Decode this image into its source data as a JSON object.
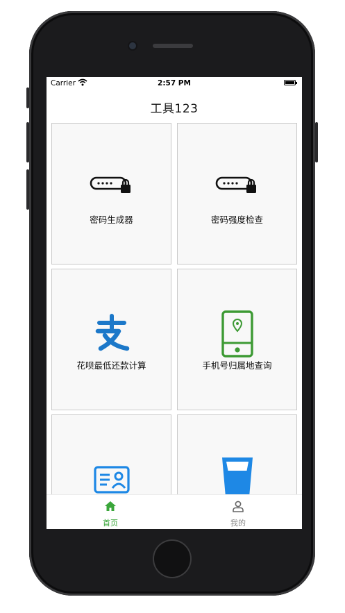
{
  "status_bar": {
    "carrier": "Carrier",
    "time": "2:57 PM"
  },
  "nav": {
    "title": "工具123"
  },
  "tools": [
    {
      "label": "密码生成器",
      "icon": "password-lock-icon"
    },
    {
      "label": "密码强度检查",
      "icon": "password-lock-icon"
    },
    {
      "label": "花呗最低还款计算",
      "icon": "alipay-icon"
    },
    {
      "label": "手机号归属地查询",
      "icon": "phone-location-icon"
    },
    {
      "label": "",
      "icon": "id-card-icon"
    },
    {
      "label": "",
      "icon": "water-glass-icon"
    }
  ],
  "tab_bar": {
    "tabs": [
      {
        "label": "首页",
        "icon": "home-icon",
        "active": true
      },
      {
        "label": "我的",
        "icon": "user-icon",
        "active": false
      }
    ]
  },
  "colors": {
    "tab_active": "#3aa63a",
    "tab_inactive": "#8a8a8a",
    "alipay_blue": "#1c78c9",
    "phone_green": "#3d9a34",
    "id_card_blue": "#1e88e5",
    "glass_blue": "#1e88e5",
    "tile_background": "#f8f8f8",
    "tile_border": "#c9c9c9"
  }
}
